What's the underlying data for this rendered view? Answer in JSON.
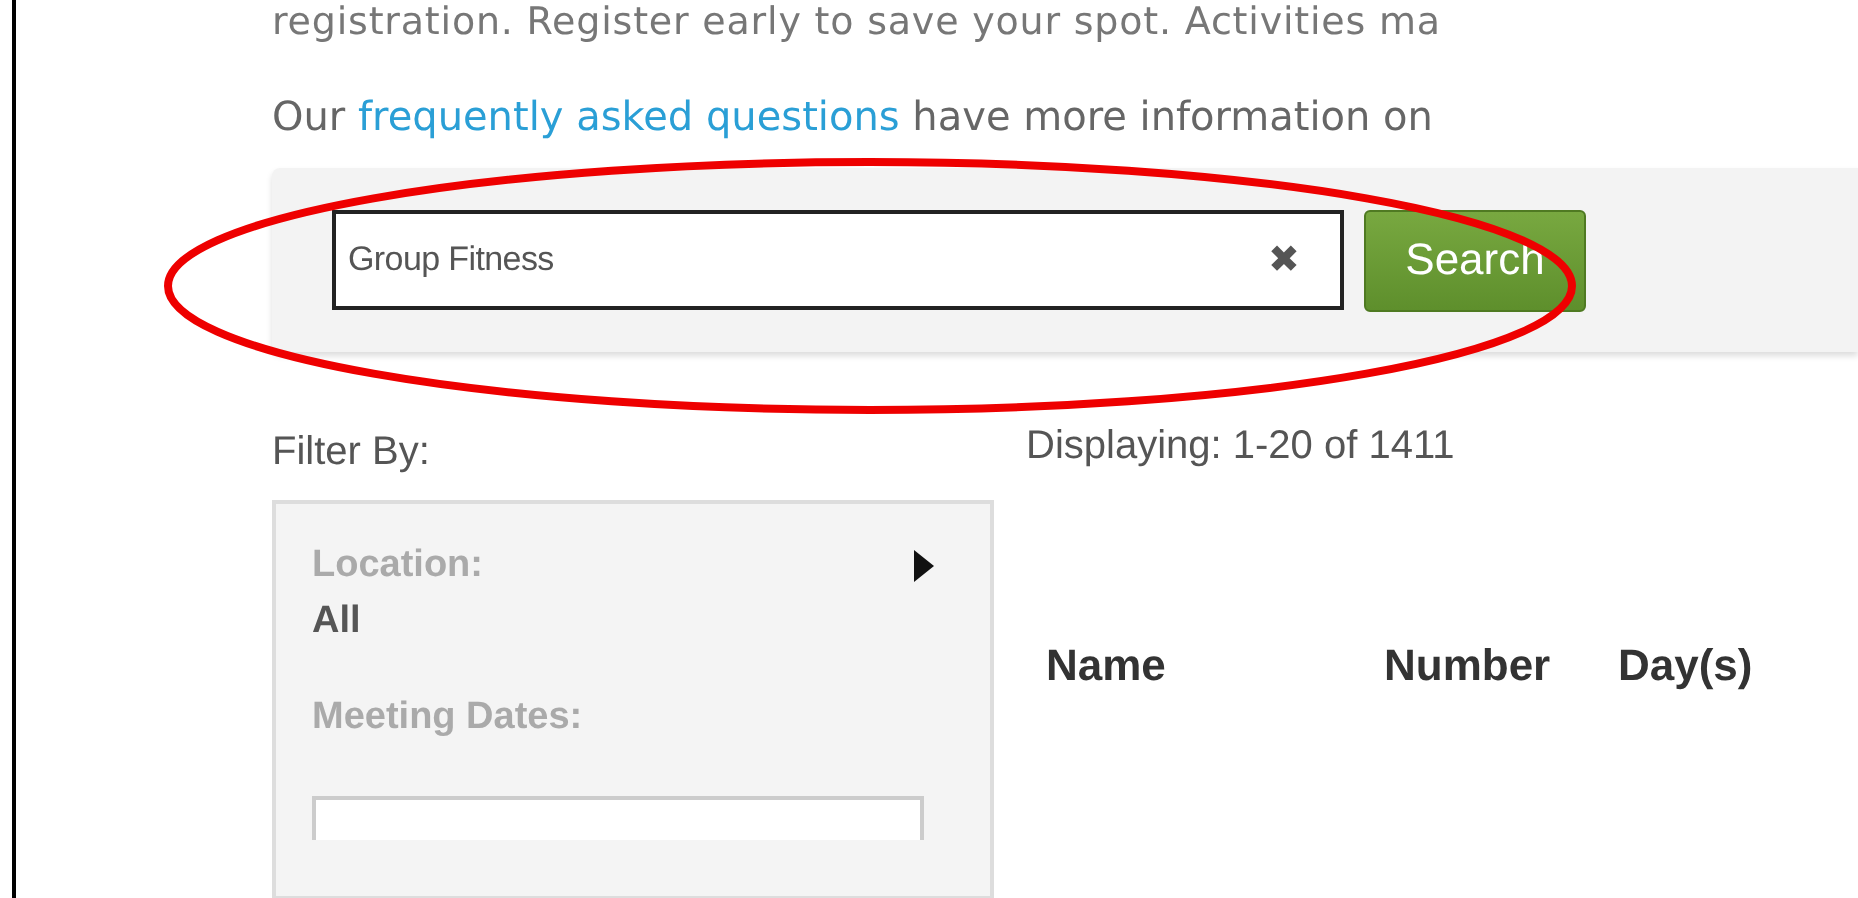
{
  "intro": {
    "cut_line": "registration. Register early to save your spot. Activities ma",
    "before_link": "Our ",
    "link": "frequently asked questions",
    "after_link": " have more information on"
  },
  "search": {
    "value": "Group Fitness",
    "clear": "✖",
    "button": "Search"
  },
  "filter_title": "Filter By:",
  "displaying": "Displaying: 1-20 of 1411",
  "filters": [
    {
      "label": "Location:",
      "value": "All",
      "expanded": false
    },
    {
      "label": "Meeting Dates:"
    }
  ],
  "table": {
    "columns": [
      "Name",
      "Number",
      "Day(s)"
    ]
  }
}
